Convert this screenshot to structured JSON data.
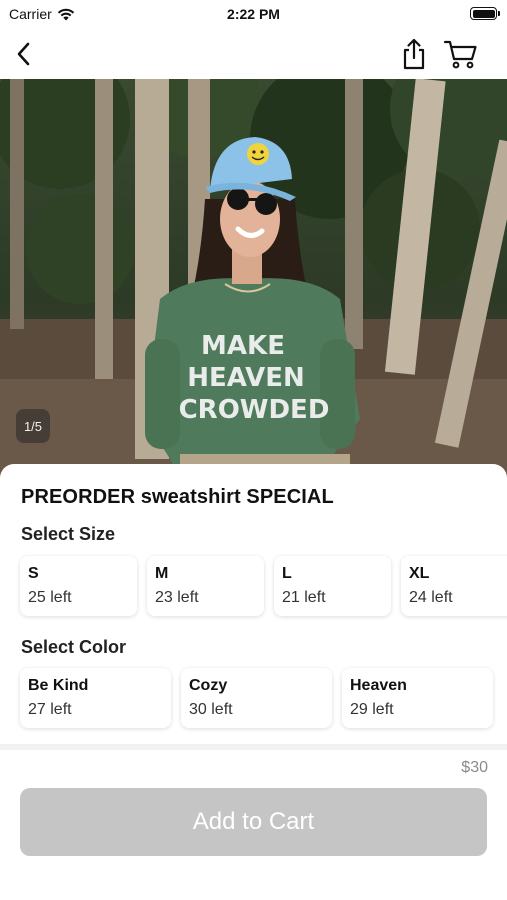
{
  "status_bar": {
    "carrier": "Carrier",
    "time": "2:22 PM",
    "icons": [
      "wifi-icon",
      "battery-icon"
    ]
  },
  "nav": {
    "icons": [
      "chevron-left-icon",
      "share-icon",
      "cart-icon"
    ]
  },
  "hero": {
    "image_counter": "1/5",
    "shirt_text": [
      "MAKE",
      "HEAVEN",
      "CROWDED"
    ]
  },
  "product": {
    "title": "PREORDER sweatshirt SPECIAL",
    "size_label": "Select Size",
    "sizes": [
      {
        "name": "S",
        "stock": "25 left"
      },
      {
        "name": "M",
        "stock": "23 left"
      },
      {
        "name": "L",
        "stock": "21 left"
      },
      {
        "name": "XL",
        "stock": "24 left"
      }
    ],
    "color_label": "Select Color",
    "colors": [
      {
        "name": "Be Kind",
        "stock": "27 left"
      },
      {
        "name": "Cozy",
        "stock": "30 left"
      },
      {
        "name": "Heaven",
        "stock": "29 left"
      }
    ]
  },
  "footer": {
    "price": "$30",
    "add_to_cart": "Add to Cart"
  },
  "colors": {
    "button_disabled": "#c5c5c5",
    "price_text": "#8a8a8a",
    "shirt_green": "#4f7a5b",
    "cap_blue": "#8cc2e8"
  }
}
